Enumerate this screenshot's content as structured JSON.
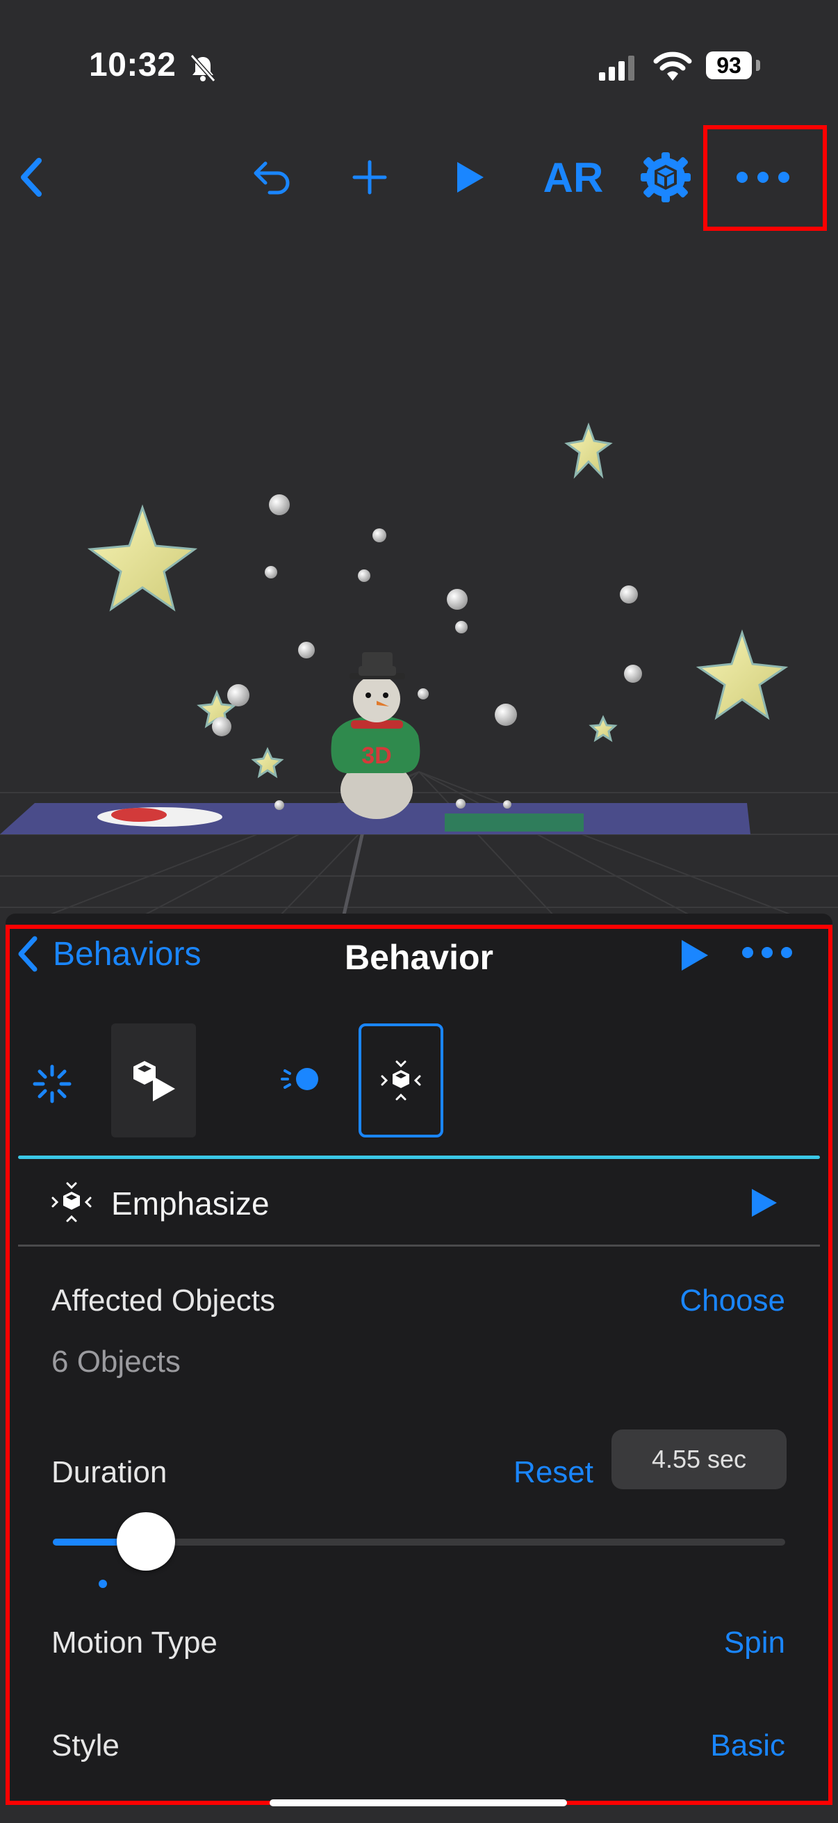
{
  "status_bar": {
    "time": "10:32",
    "battery": "93"
  },
  "toolbar": {
    "icons": [
      "back-chevron-icon",
      "undo-icon",
      "add-icon",
      "play-icon",
      "AR",
      "scene-settings-icon",
      "more-icon"
    ],
    "ar_label": "AR"
  },
  "scene": {
    "sign_text": "3D"
  },
  "panel": {
    "back_label": "Behaviors",
    "title": "Behavior",
    "action_name": "Emphasize",
    "affected_objects_label": "Affected Objects",
    "choose_label": "Choose",
    "objects_count": "6 Objects",
    "duration_label": "Duration",
    "reset_label": "Reset",
    "duration_value": "4.55 sec",
    "duration_slider_fraction": 0.08,
    "motion_type_label": "Motion Type",
    "motion_type_value": "Spin",
    "style_label": "Style",
    "style_value": "Basic"
  },
  "colors": {
    "accent": "#1a86ff",
    "highlight": "#ff0000",
    "divider_cyan": "#3ac7e6"
  }
}
